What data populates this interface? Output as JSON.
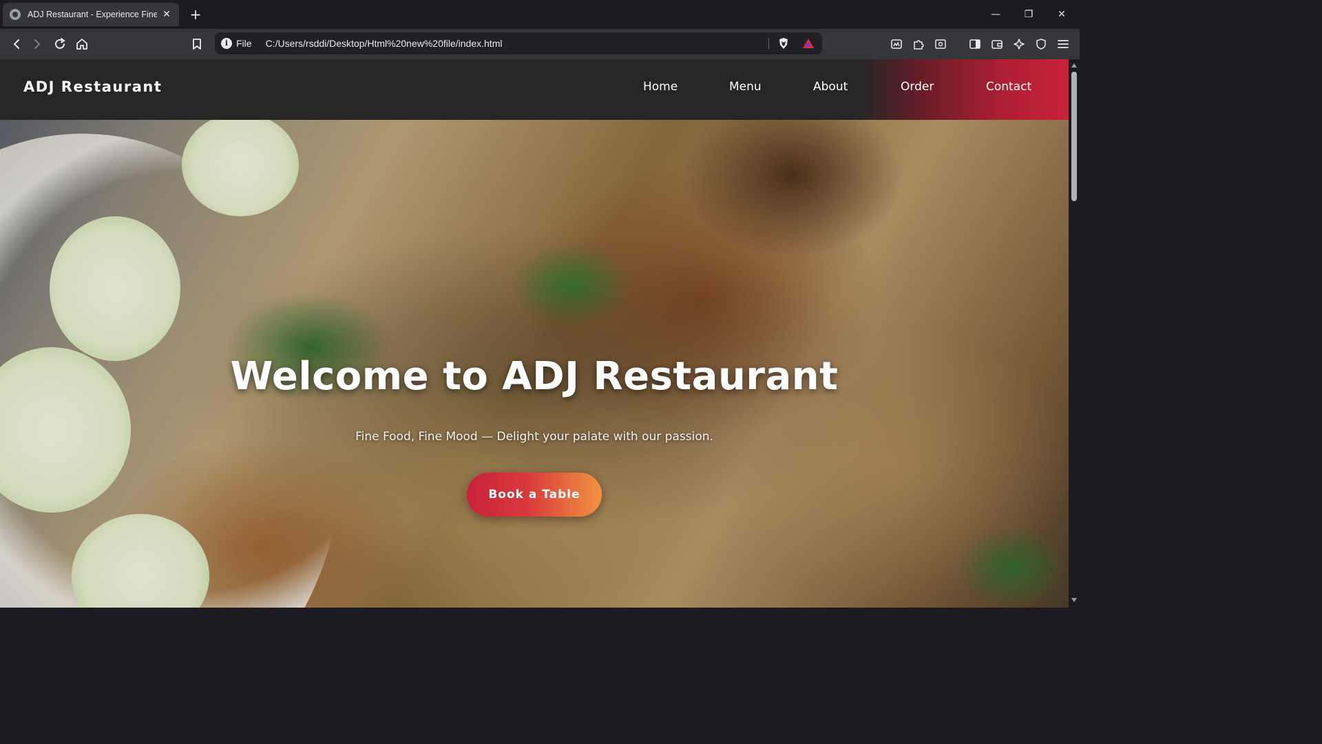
{
  "browser": {
    "tab": {
      "title": "ADJ Restaurant - Experience Fine",
      "close_glyph": "✕",
      "favicon": "globe-icon"
    },
    "new_tab_glyph": "+",
    "window_controls": {
      "minimize": "—",
      "restore": "❐",
      "close": "✕"
    },
    "address_bar": {
      "scheme_label": "File",
      "url": "C:/Users/rsddi/Desktop/Html%20new%20file/index.html"
    },
    "toolbar_icons": [
      "back-icon",
      "forward-icon",
      "reload-icon",
      "home-icon",
      "bookmark-icon",
      "brave-shields-icon",
      "brave-rewards-icon",
      "extension-icon",
      "puzzle-icon",
      "screenshot-icon",
      "sidebar-icon",
      "wallet-icon",
      "leo-ai-icon",
      "vpn-icon",
      "menu-icon"
    ]
  },
  "site": {
    "brand": "ADJ Restaurant",
    "nav": {
      "items": [
        {
          "label": "Home"
        },
        {
          "label": "Menu"
        },
        {
          "label": "About"
        },
        {
          "label": "Order"
        },
        {
          "label": "Contact"
        }
      ]
    },
    "hero": {
      "title": "Welcome to ADJ Restaurant",
      "subtitle": "Fine Food, Fine Mood — Delight your palate with our passion.",
      "cta_label": "Book a Table"
    },
    "colors": {
      "nav_bg": "#262626",
      "accent_red": "#c8213a",
      "accent_orange": "#f0933f"
    }
  }
}
